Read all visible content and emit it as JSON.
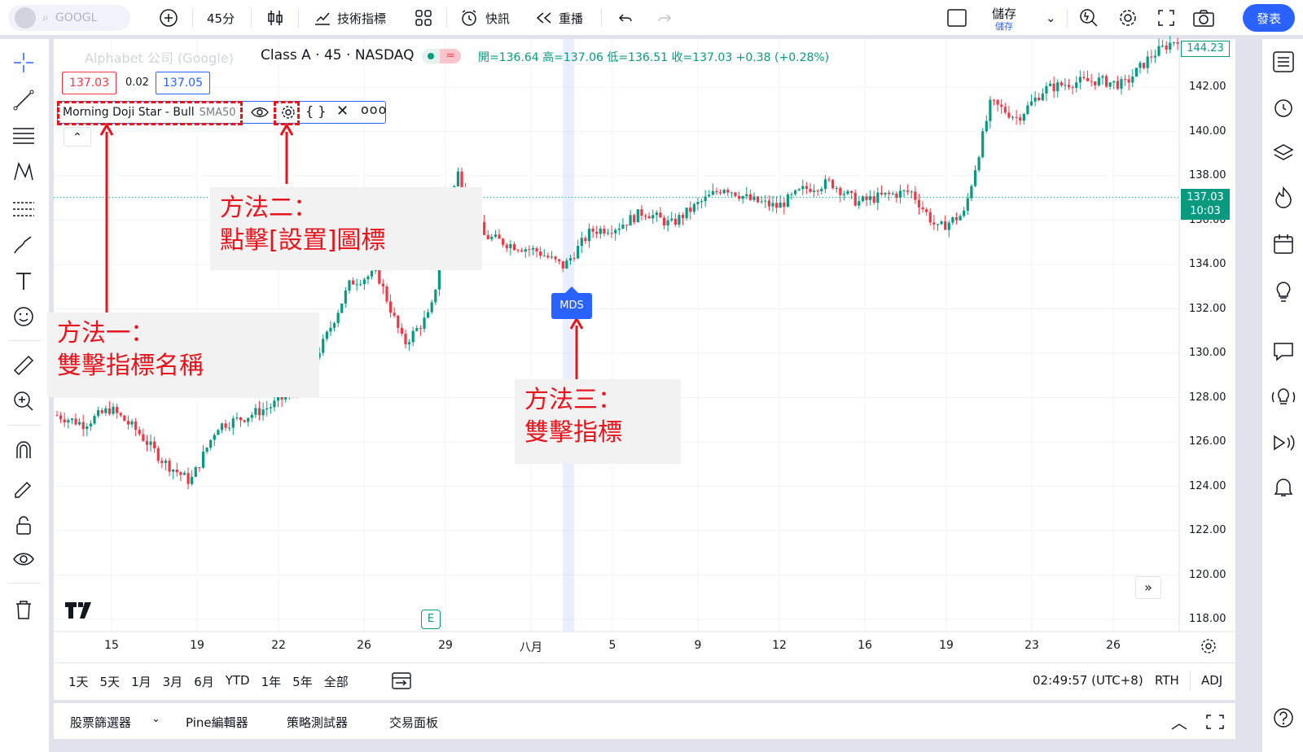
{
  "topbar": {
    "symbol_placeholder": "GOOGL",
    "interval": "45分",
    "indicators_label": "技術指標",
    "alert_label": "快訊",
    "replay_label": "重播",
    "save_label": "儲存",
    "save_sub": "儲存",
    "publish_label": "發表"
  },
  "legend": {
    "title_faded": "Alphabet 公司 (Google)",
    "title_main": "Class A · 45 · NASDAQ",
    "ohlc": "開=136.64 高=137.06 低=136.51 收=137.03 +0.38 (+0.28%)",
    "sell_price": "137.03",
    "spread": "0.02",
    "buy_price": "137.05",
    "indicator_name": "Morning Doji Star - Bull",
    "indicator_param": "SMA50"
  },
  "callouts": {
    "method1_line1": "方法一：",
    "method1_line2": "雙擊指標名稱",
    "method2_line1": "方法二：",
    "method2_line2": "點擊[設置]圖標",
    "method3_line1": "方法三：",
    "method3_line2": "雙擊指標"
  },
  "chart": {
    "marker_label": "MDS",
    "earnings_label": "E",
    "last_price": "137.03",
    "countdown": "10:03",
    "top_price": "144.23",
    "y_ticks": [
      "142.00",
      "140.00",
      "138.00",
      "136.00",
      "134.00",
      "132.00",
      "130.00",
      "128.00",
      "126.00",
      "124.00",
      "122.00",
      "120.00",
      "118.00"
    ],
    "x_ticks": [
      "15",
      "19",
      "22",
      "26",
      "29",
      "八月",
      "5",
      "9",
      "12",
      "16",
      "19",
      "23",
      "26"
    ],
    "colors": {
      "up": "#089981",
      "down": "#f23645",
      "accent": "#2962ff",
      "callout": "#e8141c"
    }
  },
  "chart_data": {
    "type": "candlestick",
    "approx_closes": [
      127.2,
      126.8,
      127.5,
      126.5,
      125.1,
      124.2,
      126.7,
      127.1,
      127.6,
      128.4,
      130.5,
      133.2,
      133.6,
      130.4,
      131.8,
      138.2,
      135.3,
      134.9,
      134.6,
      133.9,
      135.5,
      135.7,
      136.4,
      135.8,
      136.7,
      137.5,
      136.9,
      136.6,
      137.4,
      137.7,
      136.8,
      137.1,
      137.3,
      135.6,
      136.3,
      141.3,
      140.6,
      141.9,
      142.2,
      142.3,
      142.1,
      143.4,
      144.2
    ],
    "ylim": [
      117.5,
      144.5
    ]
  },
  "bottom": {
    "ranges": [
      "1天",
      "5天",
      "1月",
      "3月",
      "6月",
      "YTD",
      "1年",
      "5年",
      "全部"
    ],
    "time": "02:49:57 (UTC+8)",
    "session": "RTH",
    "adj": "ADJ"
  },
  "panel": {
    "tabs": [
      "股票篩選器",
      "Pine編輯器",
      "策略測試器",
      "交易面板"
    ]
  }
}
